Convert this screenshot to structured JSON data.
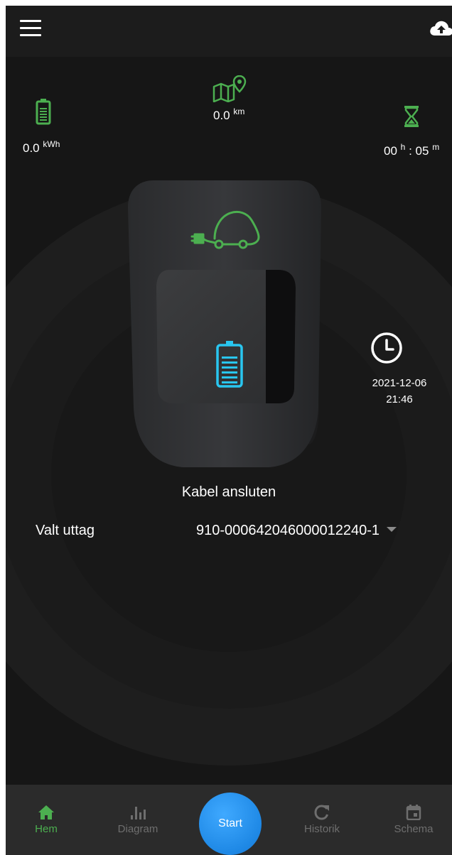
{
  "stats": {
    "energy": {
      "value": "0.0",
      "unit": "kWh",
      "icon": "battery-icon"
    },
    "distance": {
      "value": "0.0",
      "unit": "km",
      "icon": "map-pin-icon"
    },
    "duration": {
      "hours": "00",
      "hours_unit": "h",
      "separator": ":",
      "minutes": "05",
      "minutes_unit": "m",
      "icon": "hourglass-icon"
    }
  },
  "charger": {
    "icons": [
      "plug-car-icon",
      "battery-charging-icon"
    ]
  },
  "schedule": {
    "icon": "clock-icon",
    "date": "2021-12-06",
    "time": "21:46"
  },
  "status": "Kabel ansluten",
  "outlet": {
    "label": "Valt uttag",
    "selected": "910-000642046000012240-1"
  },
  "nav": {
    "items": [
      {
        "label": "Hem",
        "icon": "home-icon",
        "active": true
      },
      {
        "label": "Diagram",
        "icon": "bar-chart-icon",
        "active": false
      },
      {
        "label": "Historik",
        "icon": "refresh-icon",
        "active": false
      },
      {
        "label": "Schema",
        "icon": "calendar-icon",
        "active": false
      }
    ],
    "start_label": "Start"
  },
  "colors": {
    "accent_green": "#4caf50",
    "accent_blue": "#1e88e5",
    "charger_led": "#29c6f0",
    "background": "#161616"
  }
}
